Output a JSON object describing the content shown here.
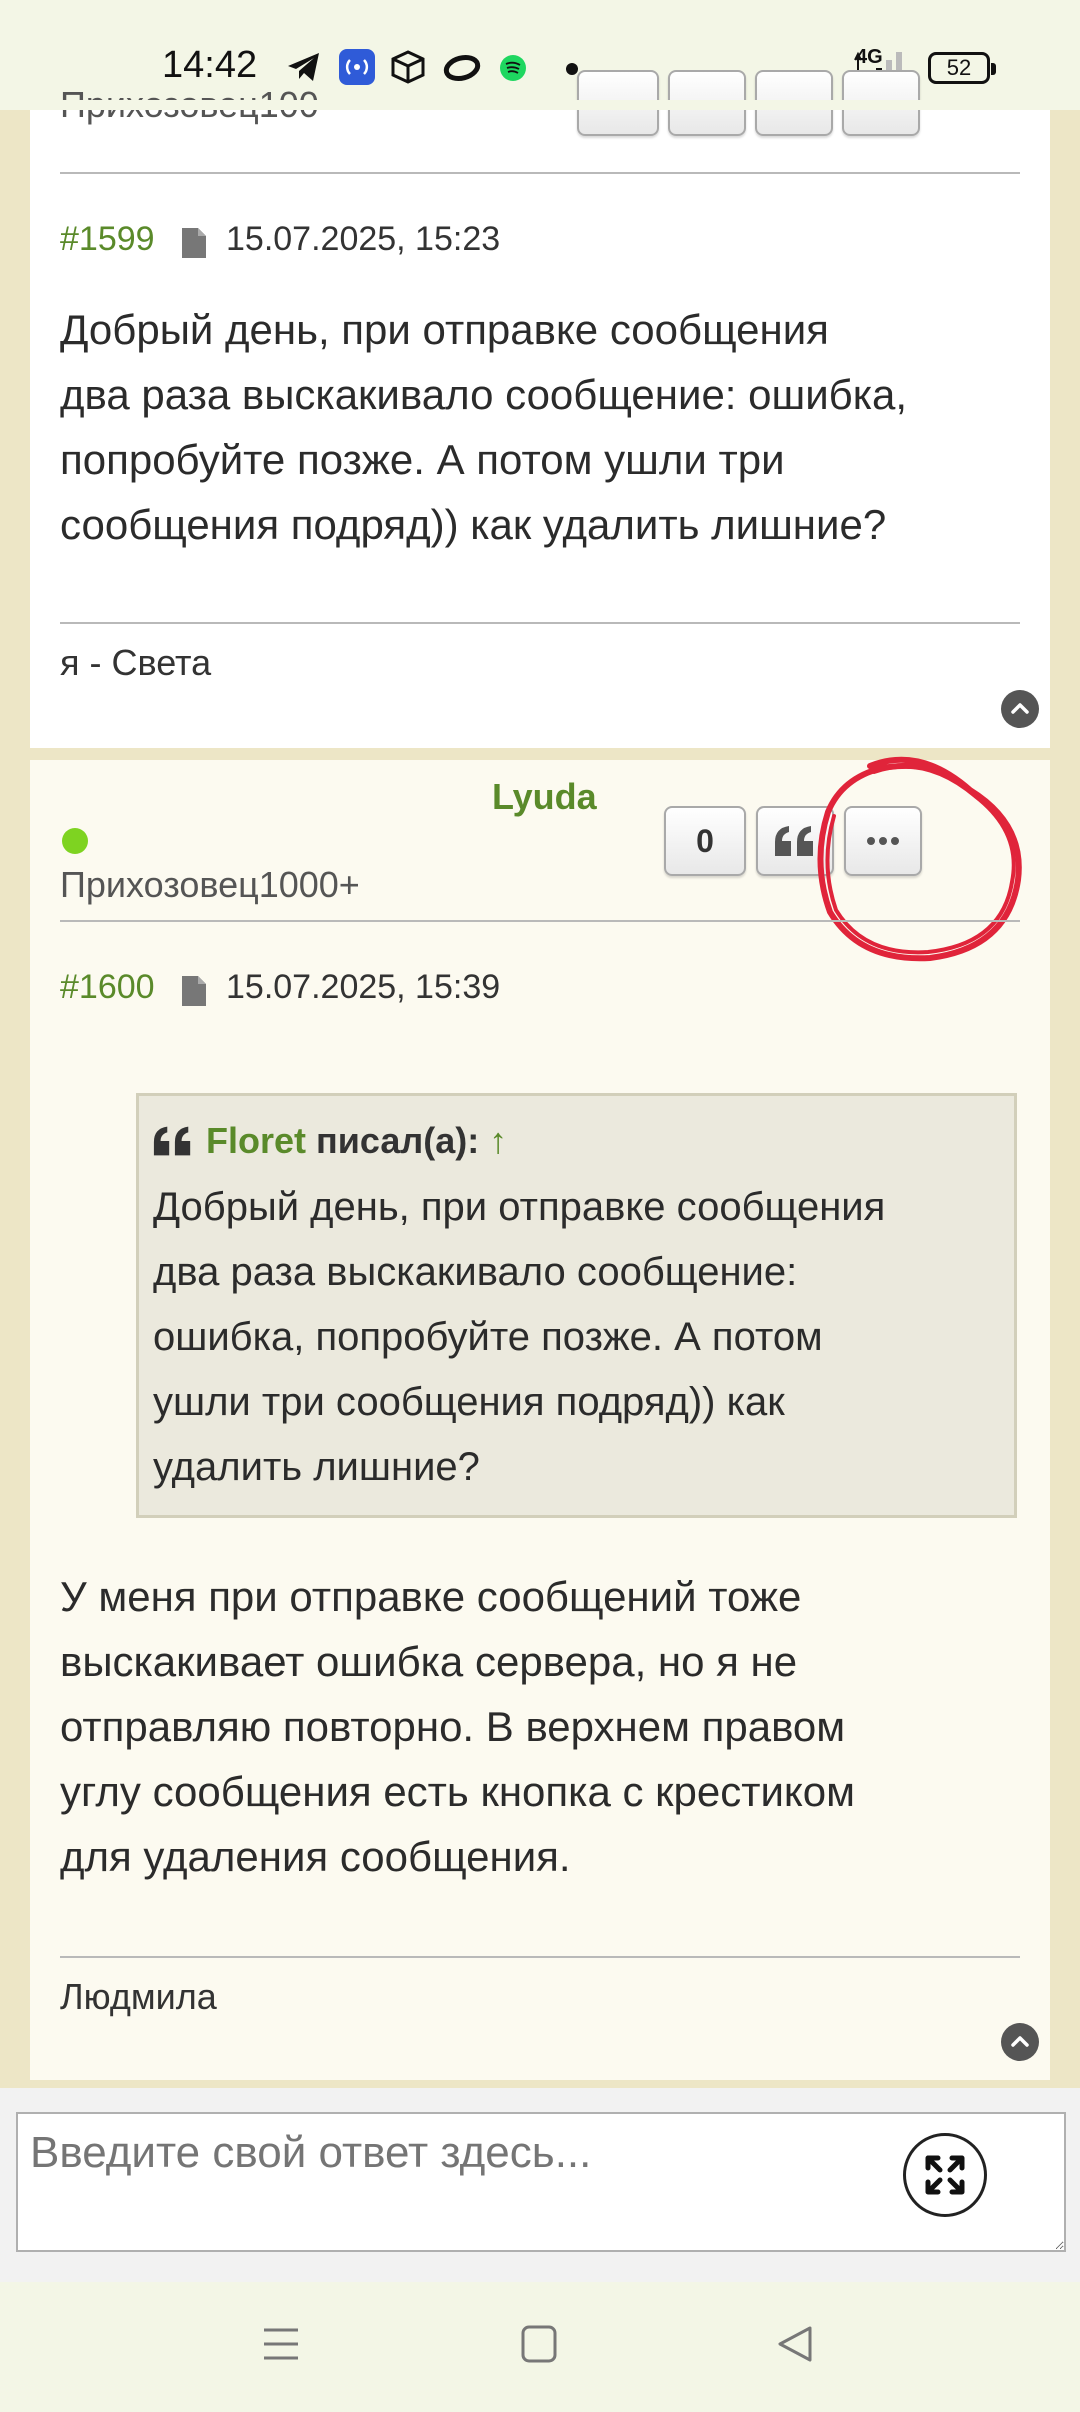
{
  "status_bar": {
    "time": "14:42",
    "network": "4G",
    "battery": "52",
    "icons": [
      "telegram-icon",
      "hotspot-icon",
      "box-icon",
      "ring-icon",
      "spotify-icon",
      "dot-icon",
      "signal-icon"
    ]
  },
  "top_partial": {
    "author_rank_partial": "Прихозовец100"
  },
  "post1599": {
    "number": "#1599",
    "date": "15.07.2025, 15:23",
    "lines": [
      "Добрый день, при отправке сообщения",
      "два раза выскакивало сообщение: ошибка,",
      "попробуйте позже. А потом ушли три",
      "сообщения подряд)) как удалить лишние?"
    ],
    "signature": "я - Света"
  },
  "post1600": {
    "author": "Lyuda",
    "rank": "Прихозовец1000+",
    "likes": "0",
    "number": "#1600",
    "date": "15.07.2025, 15:39",
    "quote": {
      "author": "Floret",
      "said": "писал(а):",
      "arrow": "↑",
      "lines": [
        "Добрый день, при отправке сообщения",
        "два раза выскакивало сообщение:",
        "ошибка, попробуйте позже. А потом",
        "ушли три сообщения подряд)) как",
        "удалить лишние?"
      ]
    },
    "lines": [
      "У меня при отправке сообщений тоже",
      "выскакивает ошибка сервера, но я не",
      "отправляю повторно. В верхнем правом",
      "углу сообщения есть кнопка с крестиком",
      "для удаления сообщения."
    ],
    "signature": "Людмила"
  },
  "reply": {
    "placeholder": "Введите свой ответ здесь..."
  },
  "colors": {
    "accent_green": "#5a8a2a",
    "online_dot": "#7ed321",
    "annotation_red": "#e0243a",
    "page_bg": "#ede6c6"
  }
}
